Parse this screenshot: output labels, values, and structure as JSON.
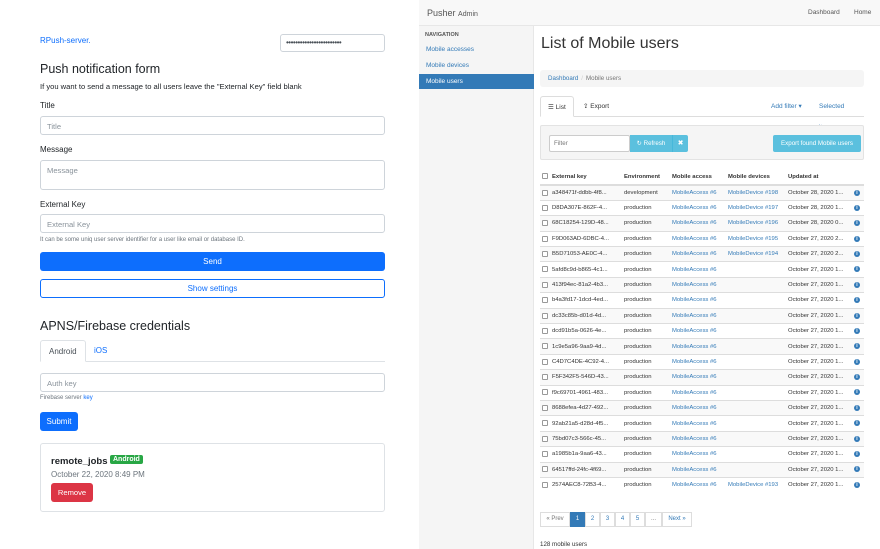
{
  "left": {
    "server_link": "RPush-server.",
    "password_dots": "••••••••••••••••••••••••",
    "push_form": {
      "heading": "Push notification form",
      "hint": "If you want to send a message to all users leave the \"External Key\" field blank",
      "title_label": "Title",
      "title_placeholder": "Title",
      "message_label": "Message",
      "message_placeholder": "Message",
      "external_key_label": "External Key",
      "external_key_placeholder": "External Key",
      "external_key_hint": "It can be some uniq user server identifier for a user like email or database ID.",
      "send_label": "Send",
      "show_settings_label": "Show settings"
    },
    "apns": {
      "heading": "APNS/Firebase credentials",
      "tabs": [
        "Android",
        "iOS"
      ],
      "auth_key_placeholder": "Auth key",
      "firebase_hint_prefix": "Firebase server",
      "firebase_hint_link": "key",
      "submit_label": "Submit"
    },
    "job": {
      "name": "remote_jobs",
      "platform": "Android",
      "date": "October 22, 2020 8:49 PM",
      "remove_label": "Remove"
    }
  },
  "right": {
    "brand": "Pusher",
    "brand_small": "Admin",
    "topnav": [
      "Dashboard",
      "Home"
    ],
    "sidebar": {
      "heading": "NAVIGATION",
      "items": [
        "Mobile accesses",
        "Mobile devices",
        "Mobile users"
      ],
      "active_index": 2
    },
    "page_title": "List of Mobile users",
    "breadcrumb": [
      "Dashboard",
      "Mobile users"
    ],
    "tabs": {
      "list": "List",
      "export": "Export",
      "add_filter": "Add filter",
      "selected_items": "Selected items"
    },
    "filter": {
      "placeholder": "Filter",
      "refresh": "Refresh",
      "clear": "✖",
      "export_found": "Export found Mobile users"
    },
    "table": {
      "headers": [
        "External key",
        "Environment",
        "Mobile access",
        "Mobile devices",
        "Updated at"
      ],
      "rows": [
        [
          "a348471f-ddbb-4f8...",
          "development",
          "MobileAccess #6",
          "MobileDevice #198",
          "October 28, 2020 1..."
        ],
        [
          "D8DA307E-862F-4...",
          "production",
          "MobileAccess #6",
          "MobileDevice #197",
          "October 28, 2020 1..."
        ],
        [
          "68C18254-129D-48...",
          "production",
          "MobileAccess #6",
          "MobileDevice #196",
          "October 28, 2020 0..."
        ],
        [
          "F9D063AD-6DBC-4...",
          "production",
          "MobileAccess #6",
          "MobileDevice #195",
          "October 27, 2020 2..."
        ],
        [
          "B5D71053-AE0C-4...",
          "production",
          "MobileAccess #6",
          "MobileDevice #194",
          "October 27, 2020 2..."
        ],
        [
          "5afd8c9d-b865-4c1...",
          "production",
          "MobileAccess #6",
          "",
          "October 27, 2020 1..."
        ],
        [
          "413f94ec-81a2-4b3...",
          "production",
          "MobileAccess #6",
          "",
          "October 27, 2020 1..."
        ],
        [
          "b4a3fd17-1dcd-4ed...",
          "production",
          "MobileAccess #6",
          "",
          "October 27, 2020 1..."
        ],
        [
          "dc33c85b-d01d-4d...",
          "production",
          "MobileAccess #6",
          "",
          "October 27, 2020 1..."
        ],
        [
          "dcd91b5a-0626-4e...",
          "production",
          "MobileAccess #6",
          "",
          "October 27, 2020 1..."
        ],
        [
          "1c9e5a96-9aa9-4d...",
          "production",
          "MobileAccess #6",
          "",
          "October 27, 2020 1..."
        ],
        [
          "C4D7C4DE-4C92-4...",
          "production",
          "MobileAccess #6",
          "",
          "October 27, 2020 1..."
        ],
        [
          "F5F342F5-546D-43...",
          "production",
          "MobileAccess #6",
          "",
          "October 27, 2020 1..."
        ],
        [
          "f9c69701-4961-483...",
          "production",
          "MobileAccess #6",
          "",
          "October 27, 2020 1..."
        ],
        [
          "8688efea-4d27-492...",
          "production",
          "MobileAccess #6",
          "",
          "October 27, 2020 1..."
        ],
        [
          "92ab21a5-d28d-4f5...",
          "production",
          "MobileAccess #6",
          "",
          "October 27, 2020 1..."
        ],
        [
          "75bd07c3-566c-45...",
          "production",
          "MobileAccess #6",
          "",
          "October 27, 2020 1..."
        ],
        [
          "a1985b1a-9aa6-43...",
          "production",
          "MobileAccess #6",
          "",
          "October 27, 2020 1..."
        ],
        [
          "64517ffd-24fc-4f69...",
          "production",
          "MobileAccess #6",
          "",
          "October 27, 2020 1..."
        ],
        [
          "2574AEC8-72B3-4...",
          "production",
          "MobileAccess #6",
          "MobileDevice #193",
          "October 27, 2020 1..."
        ]
      ]
    },
    "pagination": {
      "prev": "« Prev",
      "pages": [
        "1",
        "2",
        "3",
        "4",
        "5",
        "..."
      ],
      "next": "Next »",
      "active": "1"
    },
    "count_text": "128 mobile users"
  }
}
